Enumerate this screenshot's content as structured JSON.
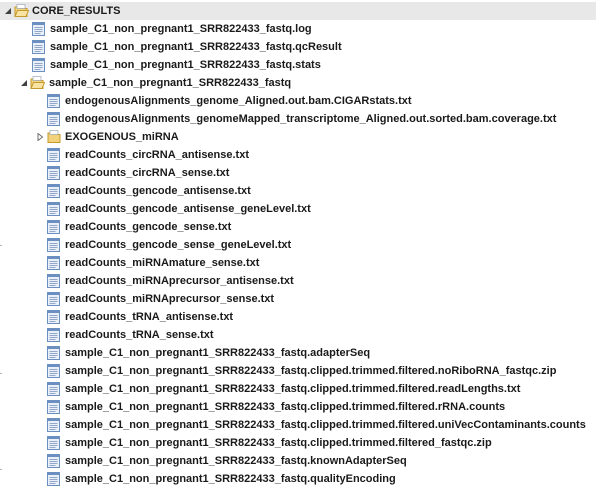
{
  "tree": {
    "root": {
      "label": "CORE_RESULTS",
      "expanded": true
    },
    "level1_files": [
      "sample_C1_non_pregnant1_SRR822433_fastq.log",
      "sample_C1_non_pregnant1_SRR822433_fastq.qcResult",
      "sample_C1_non_pregnant1_SRR822433_fastq.stats"
    ],
    "subfolder": {
      "label": "sample_C1_non_pregnant1_SRR822433_fastq",
      "expanded": true
    },
    "subfolder_files_top": [
      "endogenousAlignments_genome_Aligned.out.bam.CIGARstats.txt",
      "endogenousAlignments_genomeMapped_transcriptome_Aligned.out.sorted.bam.coverage.txt"
    ],
    "collapsed_folder": {
      "label": "EXOGENOUS_miRNA",
      "expanded": false
    },
    "subfolder_files": [
      "readCounts_circRNA_antisense.txt",
      "readCounts_circRNA_sense.txt",
      "readCounts_gencode_antisense.txt",
      "readCounts_gencode_antisense_geneLevel.txt",
      "readCounts_gencode_sense.txt",
      "readCounts_gencode_sense_geneLevel.txt",
      "readCounts_miRNAmature_sense.txt",
      "readCounts_miRNAprecursor_antisense.txt",
      "readCounts_miRNAprecursor_sense.txt",
      "readCounts_tRNA_antisense.txt",
      "readCounts_tRNA_sense.txt",
      "sample_C1_non_pregnant1_SRR822433_fastq.adapterSeq",
      "sample_C1_non_pregnant1_SRR822433_fastq.clipped.trimmed.filtered.noRiboRNA_fastqc.zip",
      "sample_C1_non_pregnant1_SRR822433_fastq.clipped.trimmed.filtered.readLengths.txt",
      "sample_C1_non_pregnant1_SRR822433_fastq.clipped.trimmed.filtered.rRNA.counts",
      "sample_C1_non_pregnant1_SRR822433_fastq.clipped.trimmed.filtered.uniVecContaminants.counts",
      "sample_C1_non_pregnant1_SRR822433_fastq.clipped.trimmed.filtered_fastqc.zip",
      "sample_C1_non_pregnant1_SRR822433_fastq.knownAdapterSeq",
      "sample_C1_non_pregnant1_SRR822433_fastq.qualityEncoding"
    ]
  },
  "colors": {
    "folder_fill": "#f2d27a",
    "folder_edge": "#c79a2e",
    "file_fill": "#e9f0fa",
    "file_edge": "#6b8fc0",
    "selected_bg": "#e8e8e8"
  }
}
